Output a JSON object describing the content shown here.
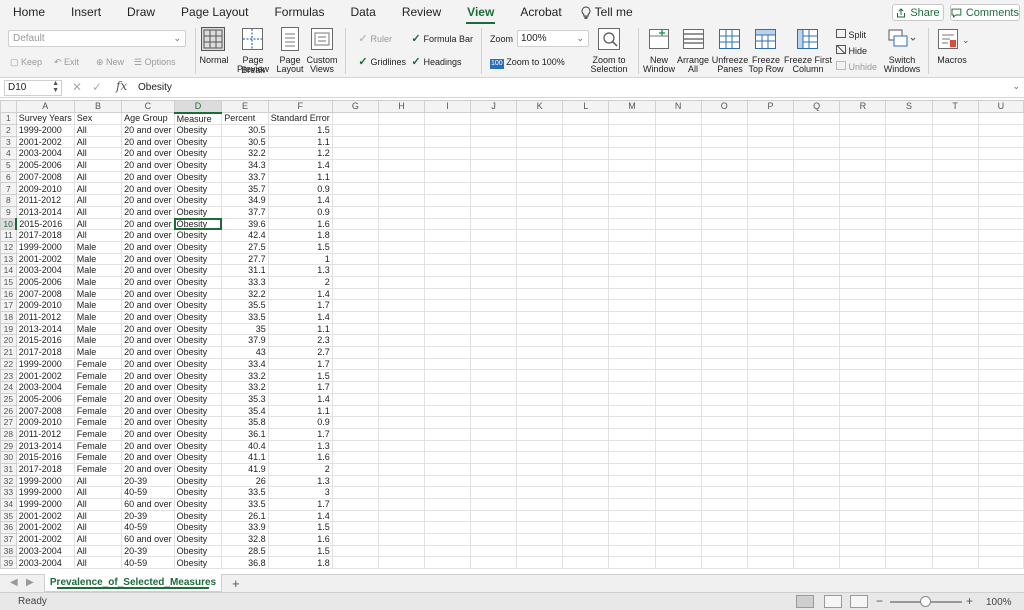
{
  "menu": {
    "tabs": [
      "Home",
      "Insert",
      "Draw",
      "Page Layout",
      "Formulas",
      "Data",
      "Review",
      "View",
      "Acrobat"
    ],
    "active": "View",
    "tell_me": "Tell me",
    "share": "Share",
    "comments": "Comments"
  },
  "ribbon": {
    "sheet_view_select": "Default",
    "keep": "Keep",
    "exit": "Exit",
    "new": "New",
    "options": "Options",
    "normal": "Normal",
    "page_break": "Page Break",
    "page_break2": "Preview",
    "page_layout": "Page",
    "page_layout2": "Layout",
    "custom_views": "Custom",
    "custom_views2": "Views",
    "ruler": "Ruler",
    "formula_bar": "Formula Bar",
    "gridlines": "Gridlines",
    "headings": "Headings",
    "zoom_label": "Zoom",
    "zoom_value": "100%",
    "zoom_100": "Zoom to 100%",
    "zoom_sel": "Zoom to",
    "zoom_sel2": "Selection",
    "new_window": "New",
    "new_window2": "Window",
    "arrange_all": "Arrange",
    "arrange_all2": "All",
    "unfreeze": "Unfreeze",
    "unfreeze2": "Panes",
    "freeze_top": "Freeze",
    "freeze_top2": "Top Row",
    "freeze_first": "Freeze First",
    "freeze_first2": "Column",
    "split": "Split",
    "hide": "Hide",
    "unhide": "Unhide",
    "switch_windows": "Switch",
    "switch_windows2": "Windows",
    "macros": "Macros"
  },
  "formula_bar": {
    "name_box": "D10",
    "formula": "Obesity"
  },
  "columns": [
    "A",
    "B",
    "C",
    "D",
    "E",
    "F",
    "G",
    "H",
    "I",
    "J",
    "K",
    "L",
    "M",
    "N",
    "O",
    "P",
    "Q",
    "R",
    "S",
    "T",
    "U"
  ],
  "selected_col": "D",
  "selected_row": 10,
  "header_row": [
    "Survey Years",
    "Sex",
    "Age Group",
    "Measure",
    "Percent",
    "Standard Error"
  ],
  "rows": [
    [
      "1999-2000",
      "All",
      "20 and over",
      "Obesity",
      "30.5",
      "1.5"
    ],
    [
      "2001-2002",
      "All",
      "20 and over",
      "Obesity",
      "30.5",
      "1.1"
    ],
    [
      "2003-2004",
      "All",
      "20 and over",
      "Obesity",
      "32.2",
      "1.2"
    ],
    [
      "2005-2006",
      "All",
      "20 and over",
      "Obesity",
      "34.3",
      "1.4"
    ],
    [
      "2007-2008",
      "All",
      "20 and over",
      "Obesity",
      "33.7",
      "1.1"
    ],
    [
      "2009-2010",
      "All",
      "20 and over",
      "Obesity",
      "35.7",
      "0.9"
    ],
    [
      "2011-2012",
      "All",
      "20 and over",
      "Obesity",
      "34.9",
      "1.4"
    ],
    [
      "2013-2014",
      "All",
      "20 and over",
      "Obesity",
      "37.7",
      "0.9"
    ],
    [
      "2015-2016",
      "All",
      "20 and over",
      "Obesity",
      "39.6",
      "1.6"
    ],
    [
      "2017-2018",
      "All",
      "20 and over",
      "Obesity",
      "42.4",
      "1.8"
    ],
    [
      "1999-2000",
      "Male",
      "20 and over",
      "Obesity",
      "27.5",
      "1.5"
    ],
    [
      "2001-2002",
      "Male",
      "20 and over",
      "Obesity",
      "27.7",
      "1"
    ],
    [
      "2003-2004",
      "Male",
      "20 and over",
      "Obesity",
      "31.1",
      "1.3"
    ],
    [
      "2005-2006",
      "Male",
      "20 and over",
      "Obesity",
      "33.3",
      "2"
    ],
    [
      "2007-2008",
      "Male",
      "20 and over",
      "Obesity",
      "32.2",
      "1.4"
    ],
    [
      "2009-2010",
      "Male",
      "20 and over",
      "Obesity",
      "35.5",
      "1.7"
    ],
    [
      "2011-2012",
      "Male",
      "20 and over",
      "Obesity",
      "33.5",
      "1.4"
    ],
    [
      "2013-2014",
      "Male",
      "20 and over",
      "Obesity",
      "35",
      "1.1"
    ],
    [
      "2015-2016",
      "Male",
      "20 and over",
      "Obesity",
      "37.9",
      "2.3"
    ],
    [
      "2017-2018",
      "Male",
      "20 and over",
      "Obesity",
      "43",
      "2.7"
    ],
    [
      "1999-2000",
      "Female",
      "20 and over",
      "Obesity",
      "33.4",
      "1.7"
    ],
    [
      "2001-2002",
      "Female",
      "20 and over",
      "Obesity",
      "33.2",
      "1.5"
    ],
    [
      "2003-2004",
      "Female",
      "20 and over",
      "Obesity",
      "33.2",
      "1.7"
    ],
    [
      "2005-2006",
      "Female",
      "20 and over",
      "Obesity",
      "35.3",
      "1.4"
    ],
    [
      "2007-2008",
      "Female",
      "20 and over",
      "Obesity",
      "35.4",
      "1.1"
    ],
    [
      "2009-2010",
      "Female",
      "20 and over",
      "Obesity",
      "35.8",
      "0.9"
    ],
    [
      "2011-2012",
      "Female",
      "20 and over",
      "Obesity",
      "36.1",
      "1.7"
    ],
    [
      "2013-2014",
      "Female",
      "20 and over",
      "Obesity",
      "40.4",
      "1.3"
    ],
    [
      "2015-2016",
      "Female",
      "20 and over",
      "Obesity",
      "41.1",
      "1.6"
    ],
    [
      "2017-2018",
      "Female",
      "20 and over",
      "Obesity",
      "41.9",
      "2"
    ],
    [
      "1999-2000",
      "All",
      "20-39",
      "Obesity",
      "26",
      "1.3"
    ],
    [
      "1999-2000",
      "All",
      "40-59",
      "Obesity",
      "33.5",
      "3"
    ],
    [
      "1999-2000",
      "All",
      "60 and over",
      "Obesity",
      "33.5",
      "1.7"
    ],
    [
      "2001-2002",
      "All",
      "20-39",
      "Obesity",
      "26.1",
      "1.4"
    ],
    [
      "2001-2002",
      "All",
      "40-59",
      "Obesity",
      "33.9",
      "1.5"
    ],
    [
      "2001-2002",
      "All",
      "60 and over",
      "Obesity",
      "32.8",
      "1.6"
    ],
    [
      "2003-2004",
      "All",
      "20-39",
      "Obesity",
      "28.5",
      "1.5"
    ],
    [
      "2003-2004",
      "All",
      "40-59",
      "Obesity",
      "36.8",
      "1.8"
    ]
  ],
  "sheet_tab": "Prevalence_of_Selected_Measures",
  "status": {
    "ready": "Ready",
    "zoom": "100%",
    "zoom_level": 0.5
  },
  "accent_color": "#1e6b3a"
}
